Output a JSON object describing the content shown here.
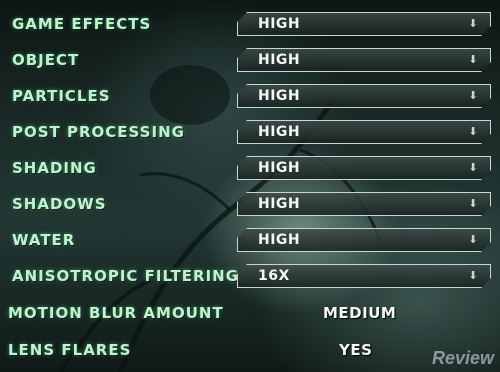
{
  "settings": [
    {
      "label": "GAME EFFECTS",
      "value": "HIGH"
    },
    {
      "label": "OBJECT",
      "value": "HIGH"
    },
    {
      "label": "PARTICLES",
      "value": "HIGH"
    },
    {
      "label": "POST PROCESSING",
      "value": "HIGH"
    },
    {
      "label": "SHADING",
      "value": "HIGH"
    },
    {
      "label": "SHADOWS",
      "value": "HIGH"
    },
    {
      "label": "WATER",
      "value": "HIGH"
    },
    {
      "label": "ANISOTROPIC FILTERING",
      "value": "16X"
    }
  ],
  "plain_settings": [
    {
      "label": "MOTION BLUR AMOUNT",
      "value": "MEDIUM"
    },
    {
      "label": "LENS FLARES",
      "value": "YES"
    }
  ],
  "dropdown_icon": "arrow-down-icon",
  "watermark": {
    "text": "Review"
  },
  "colors": {
    "label": "#bff3d0",
    "value": "#f2f7f5",
    "border": "#c9d6d2"
  }
}
